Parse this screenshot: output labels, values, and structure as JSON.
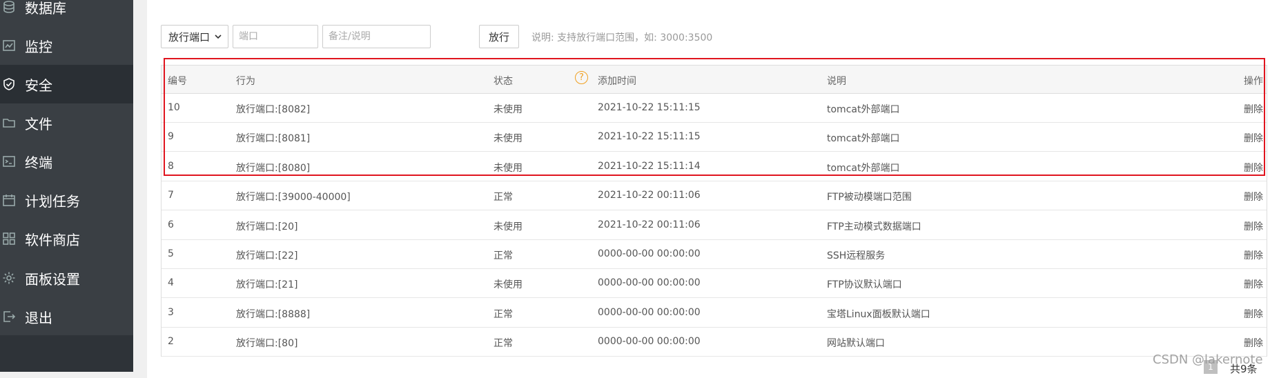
{
  "sidebar": {
    "items": [
      {
        "label": "数据库",
        "icon": "database-icon"
      },
      {
        "label": "监控",
        "icon": "monitor-icon"
      },
      {
        "label": "安全",
        "icon": "shield-icon",
        "active": true
      },
      {
        "label": "文件",
        "icon": "folder-icon"
      },
      {
        "label": "终端",
        "icon": "terminal-icon"
      },
      {
        "label": "计划任务",
        "icon": "calendar-icon"
      },
      {
        "label": "软件商店",
        "icon": "grid-icon"
      },
      {
        "label": "面板设置",
        "icon": "gear-icon"
      },
      {
        "label": "退出",
        "icon": "logout-icon"
      }
    ]
  },
  "toolbar": {
    "select_value": "放行端口",
    "port_placeholder": "端口",
    "note_placeholder": "备注/说明",
    "open_button": "放行",
    "hint": "说明: 支持放行端口范围，如: 3000:3500"
  },
  "table": {
    "headers": {
      "id": "编号",
      "action": "行为",
      "status": "状态",
      "time": "添加时间",
      "desc": "说明",
      "op": "操作"
    },
    "rows": [
      {
        "id": "10",
        "action": "放行端口:[8082]",
        "status": "未使用",
        "time": "2021-10-22 15:11:15",
        "desc": "tomcat外部端口",
        "op": "删除"
      },
      {
        "id": "9",
        "action": "放行端口:[8081]",
        "status": "未使用",
        "time": "2021-10-22 15:11:15",
        "desc": "tomcat外部端口",
        "op": "删除"
      },
      {
        "id": "8",
        "action": "放行端口:[8080]",
        "status": "未使用",
        "time": "2021-10-22 15:11:14",
        "desc": "tomcat外部端口",
        "op": "删除"
      },
      {
        "id": "7",
        "action": "放行端口:[39000-40000]",
        "status": "正常",
        "time": "2021-10-22 00:11:06",
        "desc": "FTP被动模端口范围",
        "op": "删除"
      },
      {
        "id": "6",
        "action": "放行端口:[20]",
        "status": "未使用",
        "time": "2021-10-22 00:11:06",
        "desc": "FTP主动模式数据端口",
        "op": "删除"
      },
      {
        "id": "5",
        "action": "放行端口:[22]",
        "status": "正常",
        "time": "0000-00-00 00:00:00",
        "desc": "SSH远程服务",
        "op": "删除"
      },
      {
        "id": "4",
        "action": "放行端口:[21]",
        "status": "未使用",
        "time": "0000-00-00 00:00:00",
        "desc": "FTP协议默认端口",
        "op": "删除"
      },
      {
        "id": "3",
        "action": "放行端口:[8888]",
        "status": "正常",
        "time": "0000-00-00 00:00:00",
        "desc": "宝塔Linux面板默认端口",
        "op": "删除"
      },
      {
        "id": "2",
        "action": "放行端口:[80]",
        "status": "正常",
        "time": "0000-00-00 00:00:00",
        "desc": "网站默认端口",
        "op": "删除"
      }
    ]
  },
  "pagination": {
    "page": "1",
    "total": "共9条"
  },
  "watermark": "CSDN @lakernote",
  "colors": {
    "accent_green": "#20a53a",
    "highlight_red": "#e0141e",
    "sidebar_bg": "#3a3f44"
  }
}
